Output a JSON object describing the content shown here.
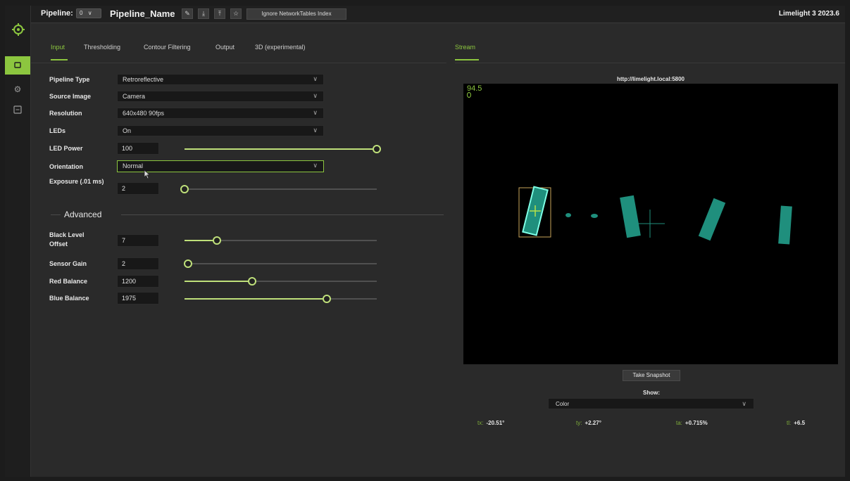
{
  "topbar": {
    "pipeline_label": "Pipeline:",
    "pipeline_index": "0",
    "pipeline_name": "Pipeline_Name",
    "ignore_nt_label": "Ignore NetworkTables Index",
    "version": "Limelight 3 2023.6"
  },
  "sidebar": {
    "items": [
      {
        "icon": "camera-icon",
        "active": true
      },
      {
        "icon": "gear-icon",
        "active": false
      },
      {
        "icon": "terminal-icon",
        "active": false
      }
    ]
  },
  "tabs": {
    "input": "Input",
    "thresholding": "Thresholding",
    "contour": "Contour Filtering",
    "output": "Output",
    "threed": "3D (experimental)",
    "stream": "Stream"
  },
  "form": {
    "pipeline_type": {
      "label": "Pipeline Type",
      "value": "Retroreflective"
    },
    "source_image": {
      "label": "Source Image",
      "value": "Camera"
    },
    "resolution": {
      "label": "Resolution",
      "value": "640x480 90fps"
    },
    "leds": {
      "label": "LEDs",
      "value": "On"
    },
    "led_power": {
      "label": "LED Power",
      "value": "100",
      "level": 1.0
    },
    "orientation": {
      "label": "Orientation",
      "value": "Normal"
    },
    "exposure": {
      "label": "Exposure (.01 ms)",
      "value": "2",
      "level": 0.0
    },
    "advanced_label": "Advanced",
    "black_level": {
      "label": "Black Level Offset",
      "value": "7",
      "level": 0.17
    },
    "sensor_gain": {
      "label": "Sensor Gain",
      "value": "2",
      "level": 0.02
    },
    "red_balance": {
      "label": "Red Balance",
      "value": "1200",
      "level": 0.35
    },
    "blue_balance": {
      "label": "Blue Balance",
      "value": "1975",
      "level": 0.74
    }
  },
  "stream": {
    "url": "http://limelight.local:5800",
    "fps": "94.5",
    "snapshot_label": "Take Snapshot",
    "show_label": "Show:",
    "show_value": "Color"
  },
  "metrics": {
    "tx": {
      "key": "tx:",
      "value": "-20.51°"
    },
    "ty": {
      "key": "ty:",
      "value": "+2.27°"
    },
    "ta": {
      "key": "ta:",
      "value": "+0.715%"
    },
    "tl": {
      "key": "tl:",
      "value": "+6.5"
    }
  },
  "colors": {
    "accent": "#8cc63f",
    "target": "#1f8f7d"
  }
}
